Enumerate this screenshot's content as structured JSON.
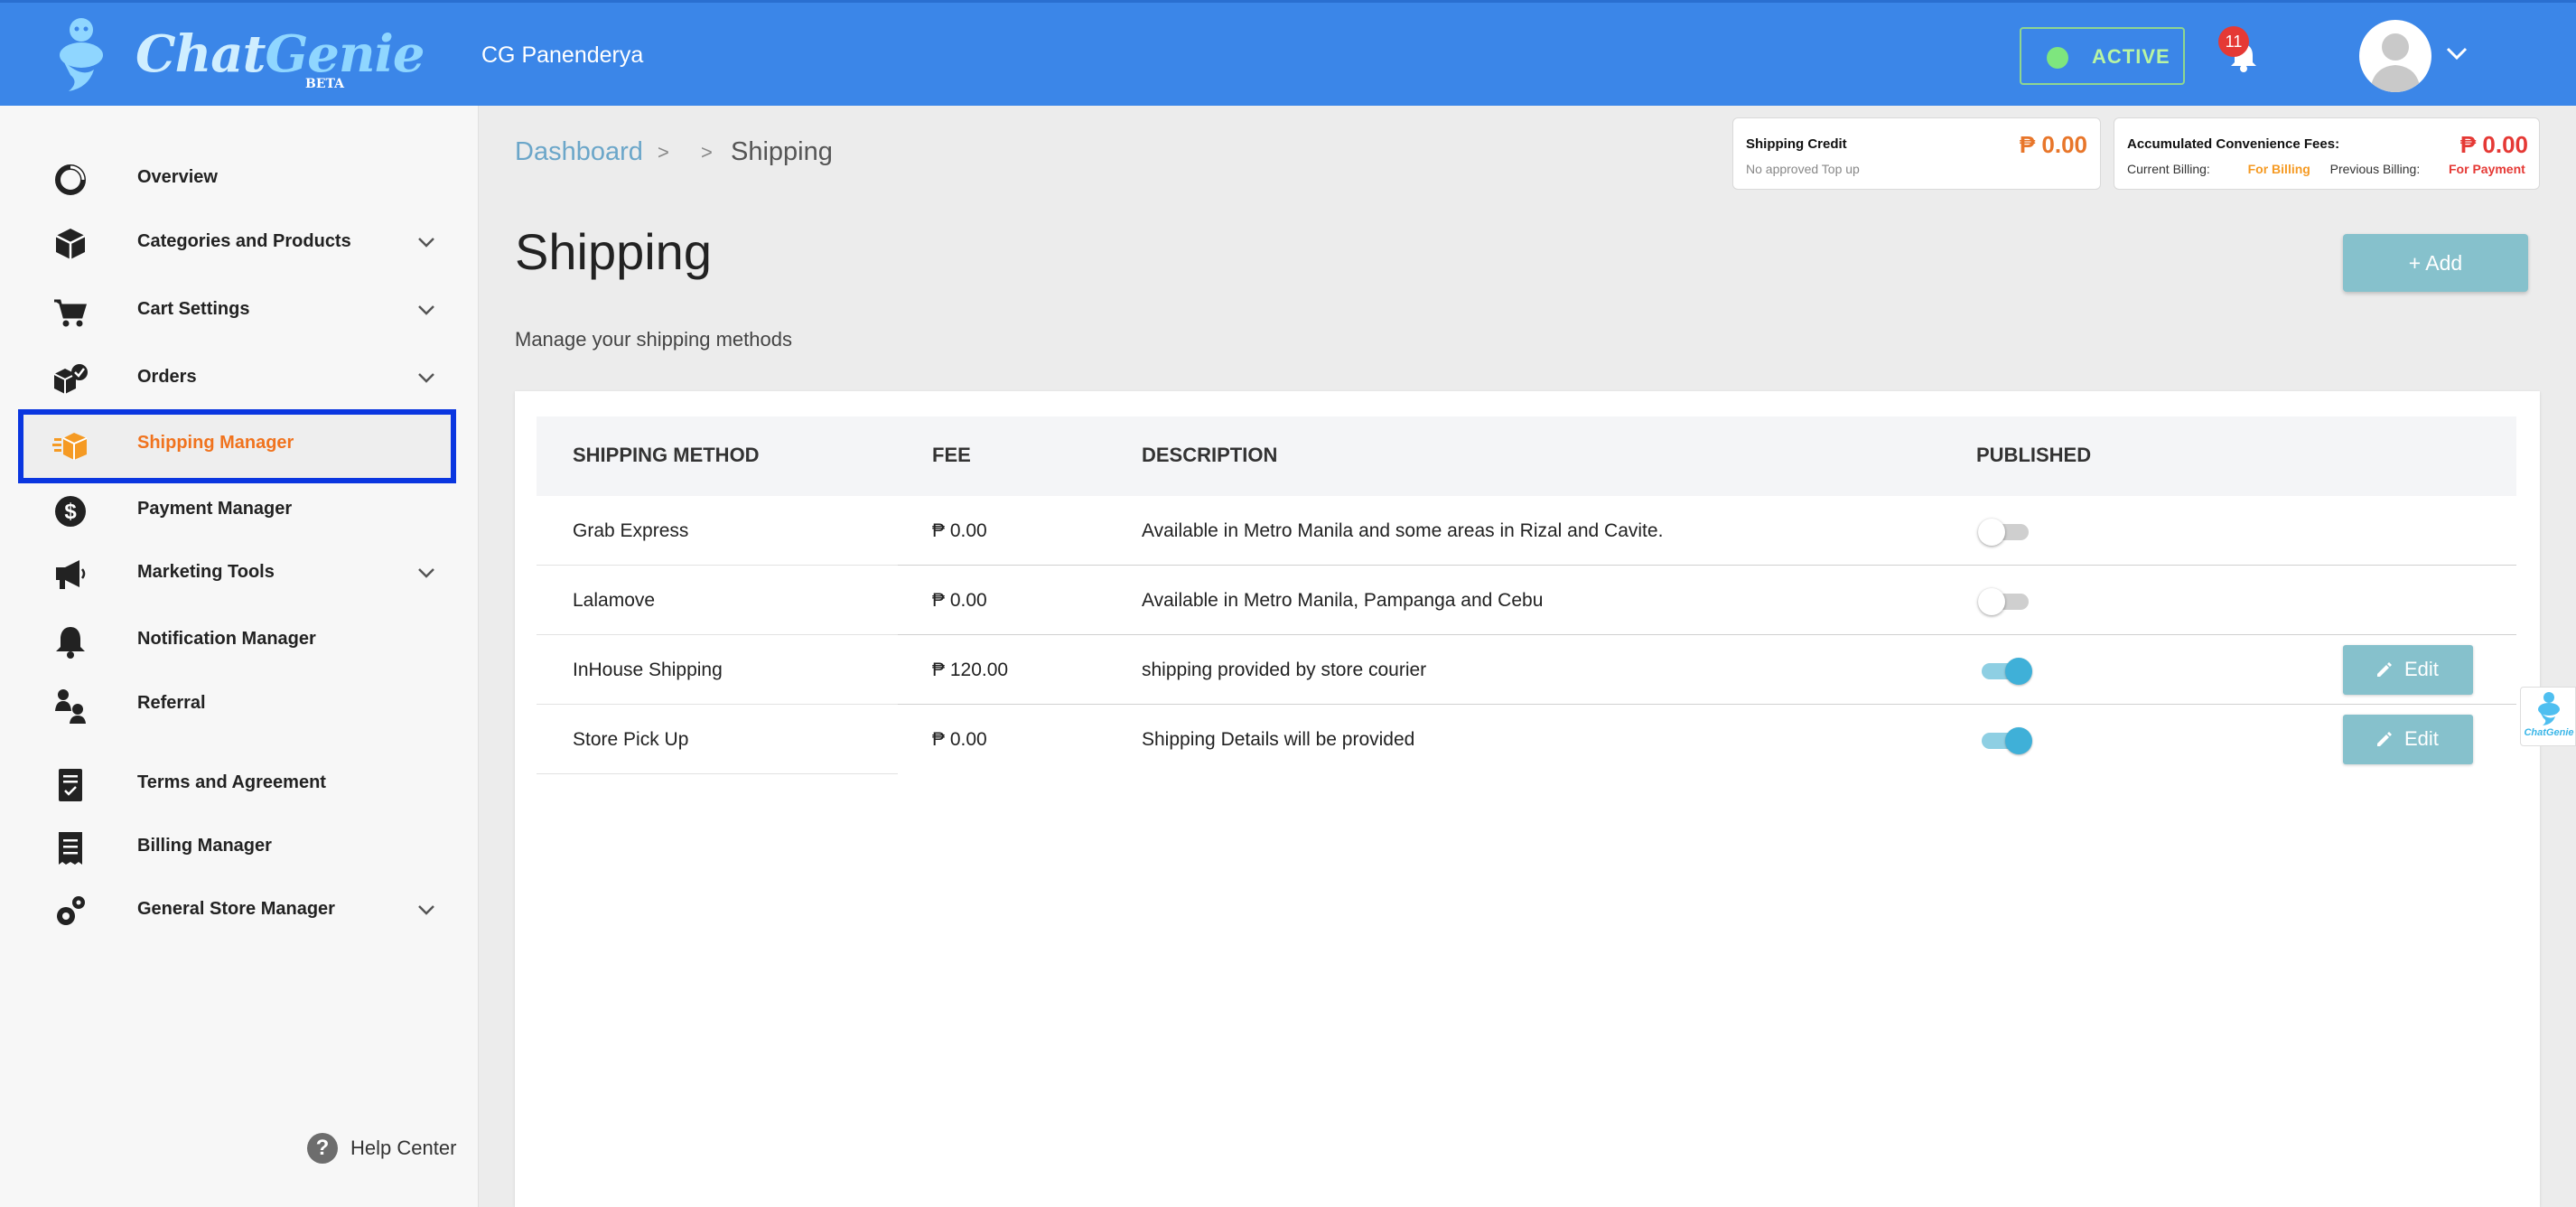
{
  "app": {
    "logo_main": "Chat",
    "logo_accent": "Genie",
    "logo_beta": "BETA",
    "store_name": "CG Panenderya"
  },
  "header": {
    "status": "ACTIVE",
    "notification_count": "11"
  },
  "sidebar": {
    "items": [
      {
        "label": "Overview",
        "icon": "overview-icon"
      },
      {
        "label": "Categories and Products",
        "icon": "box-icon"
      },
      {
        "label": "Cart Settings",
        "icon": "cart-icon"
      },
      {
        "label": "Orders",
        "icon": "orders-icon"
      },
      {
        "label": "Shipping Manager",
        "icon": "shipping-icon",
        "selected": true
      },
      {
        "label": "Payment Manager",
        "icon": "dollar-icon"
      },
      {
        "label": "Marketing Tools",
        "icon": "megaphone-icon"
      },
      {
        "label": "Notification Manager",
        "icon": "bell-icon"
      },
      {
        "label": "Referral",
        "icon": "referral-icon"
      },
      {
        "label": "Terms and Agreement",
        "icon": "document-icon"
      },
      {
        "label": "Billing Manager",
        "icon": "receipt-icon"
      },
      {
        "label": "General Store Manager",
        "icon": "gears-icon"
      }
    ],
    "help_label": "Help Center",
    "help_glyph": "?"
  },
  "breadcrumb": {
    "root": "Dashboard",
    "sep": ">",
    "current": "Shipping"
  },
  "credit": {
    "title": "Shipping Credit",
    "amount": "₱ 0.00",
    "sub": "No approved Top up"
  },
  "fees": {
    "title": "Accumulated Convenience Fees:",
    "amount": "₱ 0.00",
    "current_label": "Current Billing:",
    "current_value": "For Billing",
    "previous_label": "Previous Billing:",
    "previous_value": "For Payment"
  },
  "page": {
    "title": "Shipping",
    "subtitle": "Manage your shipping methods",
    "add_label": "+  Add"
  },
  "table": {
    "headers": {
      "method": "SHIPPING METHOD",
      "fee": "FEE",
      "description": "DESCRIPTION",
      "published": "PUBLISHED"
    },
    "rows": [
      {
        "method": "Grab Express",
        "fee": "₱ 0.00",
        "description": "Available in Metro Manila and some areas in Rizal and Cavite.",
        "published": false
      },
      {
        "method": "Lalamove",
        "fee": "₱ 0.00",
        "description": "Available in Metro Manila, Pampanga and Cebu",
        "published": false
      },
      {
        "method": "InHouse Shipping",
        "fee": "₱ 120.00",
        "description": "shipping provided by store courier",
        "published": true,
        "edit_label": "Edit"
      },
      {
        "method": "Store Pick Up",
        "fee": "₱ 0.00",
        "description": "Shipping Details will be provided",
        "published": true,
        "edit_label": "Edit"
      }
    ]
  },
  "widget": {
    "label": "ChatGenie"
  },
  "colors": {
    "header": "#3b86e8",
    "accent_orange": "#f0731e",
    "button": "#86c1cc",
    "toggle_on": "#3fb0d8",
    "selected_outline": "#0a36e0"
  }
}
